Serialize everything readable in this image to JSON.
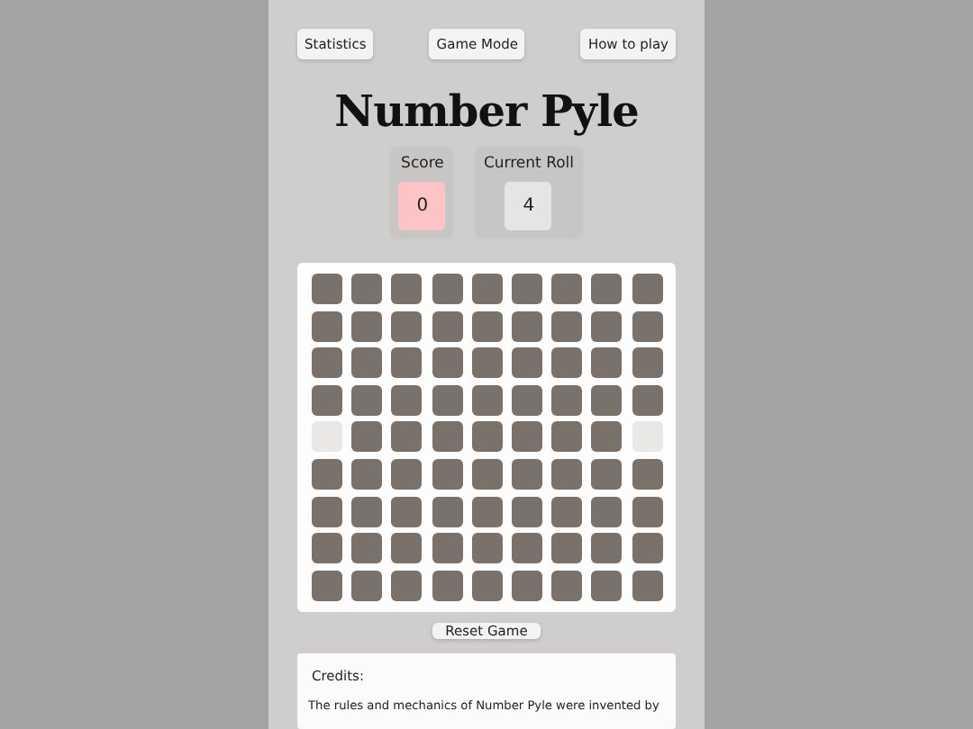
{
  "top_buttons": [
    "Statistics",
    "Game Mode",
    "How to play"
  ],
  "title": "Number Pyle",
  "score": {
    "label": "Score",
    "value": "0"
  },
  "current_roll": {
    "label": "Current Roll",
    "value": "4"
  },
  "board": {
    "rows": [
      [
        {
          "filled": true
        },
        {
          "filled": true
        },
        {
          "filled": true
        },
        {
          "filled": true
        },
        {
          "filled": true
        },
        {
          "filled": true
        },
        {
          "filled": true
        },
        {
          "filled": true
        },
        {
          "filled": true
        }
      ],
      [
        {
          "filled": true
        },
        {
          "filled": true
        },
        {
          "filled": true
        },
        {
          "filled": true
        },
        {
          "filled": true
        },
        {
          "filled": true
        },
        {
          "filled": true
        },
        {
          "filled": true
        },
        {
          "filled": true
        }
      ],
      [
        {
          "filled": true
        },
        {
          "filled": true
        },
        {
          "filled": true
        },
        {
          "filled": true
        },
        {
          "filled": true
        },
        {
          "filled": true
        },
        {
          "filled": true
        },
        {
          "filled": true
        },
        {
          "filled": true
        }
      ],
      [
        {
          "filled": true
        },
        {
          "filled": true
        },
        {
          "filled": true
        },
        {
          "filled": true
        },
        {
          "filled": true
        },
        {
          "filled": true
        },
        {
          "filled": true
        },
        {
          "filled": true
        },
        {
          "filled": true
        }
      ],
      [
        {
          "filled": false
        },
        {
          "filled": true
        },
        {
          "filled": true
        },
        {
          "filled": true
        },
        {
          "filled": true
        },
        {
          "filled": true
        },
        {
          "filled": true
        },
        {
          "filled": true
        },
        {
          "filled": false
        }
      ],
      [
        {
          "filled": true
        },
        {
          "filled": true
        },
        {
          "filled": true
        },
        {
          "filled": true
        },
        {
          "filled": true
        },
        {
          "filled": true
        },
        {
          "filled": true
        },
        {
          "filled": true
        },
        {
          "filled": true
        }
      ],
      [
        {
          "filled": true
        },
        {
          "filled": true
        },
        {
          "filled": true
        },
        {
          "filled": true
        },
        {
          "filled": true
        },
        {
          "filled": true
        },
        {
          "filled": true
        },
        {
          "filled": true
        },
        {
          "filled": true
        }
      ],
      [
        {
          "filled": true
        },
        {
          "filled": true
        },
        {
          "filled": true
        },
        {
          "filled": true
        },
        {
          "filled": true
        },
        {
          "filled": true
        },
        {
          "filled": true
        },
        {
          "filled": true
        },
        {
          "filled": true
        }
      ],
      [
        {
          "filled": true
        },
        {
          "filled": true
        },
        {
          "filled": true
        },
        {
          "filled": true
        },
        {
          "filled": true
        },
        {
          "filled": true
        },
        {
          "filled": true
        },
        {
          "filled": true
        },
        {
          "filled": true
        }
      ]
    ]
  },
  "reset_button": "Reset Game",
  "credits": {
    "heading": "Credits:",
    "text": "The rules and mechanics of Number Pyle were invented by"
  }
}
